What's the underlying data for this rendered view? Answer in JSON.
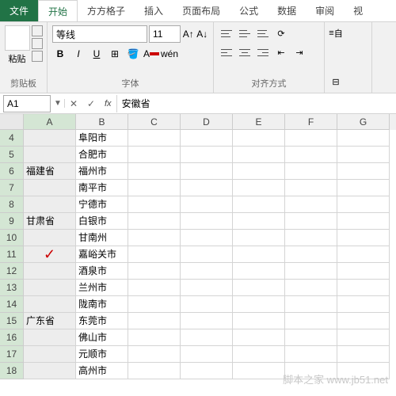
{
  "tabs": {
    "file": "文件",
    "home": "开始",
    "grid": "方方格子",
    "insert": "插入",
    "layout": "页面布局",
    "formula": "公式",
    "data": "数据",
    "review": "审阅",
    "view": "视"
  },
  "ribbon": {
    "clipboard_label": "剪贴板",
    "paste": "粘贴",
    "font_name": "等线",
    "font_size": "11",
    "font_label": "字体",
    "align_label": "对齐方式",
    "wrap": "自"
  },
  "formula_bar": {
    "name_box": "A1",
    "fx": "fx",
    "value": "安徽省"
  },
  "columns": [
    "A",
    "B",
    "C",
    "D",
    "E",
    "F",
    "G"
  ],
  "rows": [
    {
      "n": "4",
      "a": "",
      "b": "阜阳市"
    },
    {
      "n": "5",
      "a": "",
      "b": "合肥市"
    },
    {
      "n": "6",
      "a": "福建省",
      "b": "福州市"
    },
    {
      "n": "7",
      "a": "",
      "b": "南平市"
    },
    {
      "n": "8",
      "a": "",
      "b": "宁德市"
    },
    {
      "n": "9",
      "a": "甘肃省",
      "b": "白银市"
    },
    {
      "n": "10",
      "a": "",
      "b": "甘南州"
    },
    {
      "n": "11",
      "a": "✓",
      "b": "嘉峪关市",
      "check": true
    },
    {
      "n": "12",
      "a": "",
      "b": "酒泉市"
    },
    {
      "n": "13",
      "a": "",
      "b": "兰州市"
    },
    {
      "n": "14",
      "a": "",
      "b": "陇南市"
    },
    {
      "n": "15",
      "a": "广东省",
      "b": "东莞市"
    },
    {
      "n": "16",
      "a": "",
      "b": "佛山市"
    },
    {
      "n": "17",
      "a": "",
      "b": "元顺市"
    },
    {
      "n": "18",
      "a": "",
      "b": "高州市"
    }
  ],
  "watermark": "脚本之家 www.jb51.net"
}
